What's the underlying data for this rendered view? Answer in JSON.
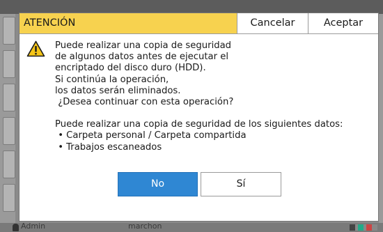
{
  "dialog": {
    "title": "ATENCIÓN",
    "cancel_label": "Cancelar",
    "accept_label": "Aceptar",
    "message_lines": [
      "Puede realizar una copia de seguridad",
      "de algunos datos antes de ejecutar el",
      "encriptado del disco duro (HDD).",
      "Si continúa la operación,",
      "los datos serán eliminados.",
      " ¿Desea continuar con esta operación?"
    ],
    "backup_lines": [
      "Puede realizar una copia de seguridad de los siguientes datos:",
      " • Carpeta personal / Carpeta compartida",
      " • Trabajos escaneados"
    ],
    "no_label": "No",
    "yes_label": "Sí",
    "icon": "warning-icon",
    "colors": {
      "title_bg": "#f7d24f",
      "primary_button": "#2f87d3"
    }
  },
  "status_bar": {
    "user": "Admin",
    "machine": "marchon"
  }
}
